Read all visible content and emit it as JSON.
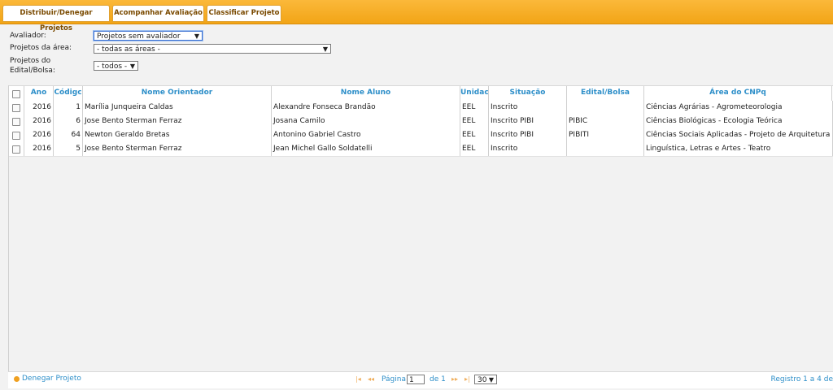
{
  "tabs": [
    "Distribuir/Denegar Projetos",
    "Acompanhar Avaliação",
    "Classificar Projeto"
  ],
  "filters": {
    "avaliador_label": "Avaliador:",
    "avaliador_value": "Projetos sem avaliador",
    "area_label": "Projetos da área:",
    "area_value": "- todas as áreas -",
    "edital_label_1": "Projetos do",
    "edital_label_2": "Edital/Bolsa:",
    "edital_value": "- todos -"
  },
  "table": {
    "columns": [
      "Ano",
      "Códigc",
      "Nome Orientador",
      "Nome Aluno",
      "Unidac",
      "Situação",
      "Edital/Bolsa",
      "Área do CNPq"
    ],
    "rows": [
      {
        "ano": "2016",
        "codigo": "1",
        "orientador": "Marília Junqueira Caldas",
        "aluno": "Alexandre Fonseca Brandão",
        "unidade": "EEL",
        "situacao": "Inscrito",
        "edital": "",
        "area": "Ciências Agrárias - Agrometeorologia"
      },
      {
        "ano": "2016",
        "codigo": "6",
        "orientador": "Jose Bento Sterman Ferraz",
        "aluno": "Josana Camilo",
        "unidade": "EEL",
        "situacao": "Inscrito PIBI",
        "edital": "PIBIC",
        "area": "Ciências Biológicas - Ecologia Teórica"
      },
      {
        "ano": "2016",
        "codigo": "64",
        "orientador": "Newton Geraldo Bretas",
        "aluno": "Antonino Gabriel Castro",
        "unidade": "EEL",
        "situacao": "Inscrito PIBI",
        "edital": "PIBITI",
        "area": "Ciências Sociais Aplicadas - Projeto de Arquitetura e"
      },
      {
        "ano": "2016",
        "codigo": "5",
        "orientador": "Jose Bento Sterman Ferraz",
        "aluno": "Jean Michel Gallo Soldatelli",
        "unidade": "EEL",
        "situacao": "Inscrito",
        "edital": "",
        "area": "Linguística, Letras e Artes - Teatro"
      }
    ]
  },
  "footer": {
    "denegar": "Denegar Projeto",
    "pagina_label": "Página",
    "page_value": "1",
    "de_label": "de 1",
    "page_size": "30",
    "registros": "Registro 1 a 4 de"
  },
  "colors": {
    "accent": "#f2a516",
    "link": "#2e8fc9"
  }
}
